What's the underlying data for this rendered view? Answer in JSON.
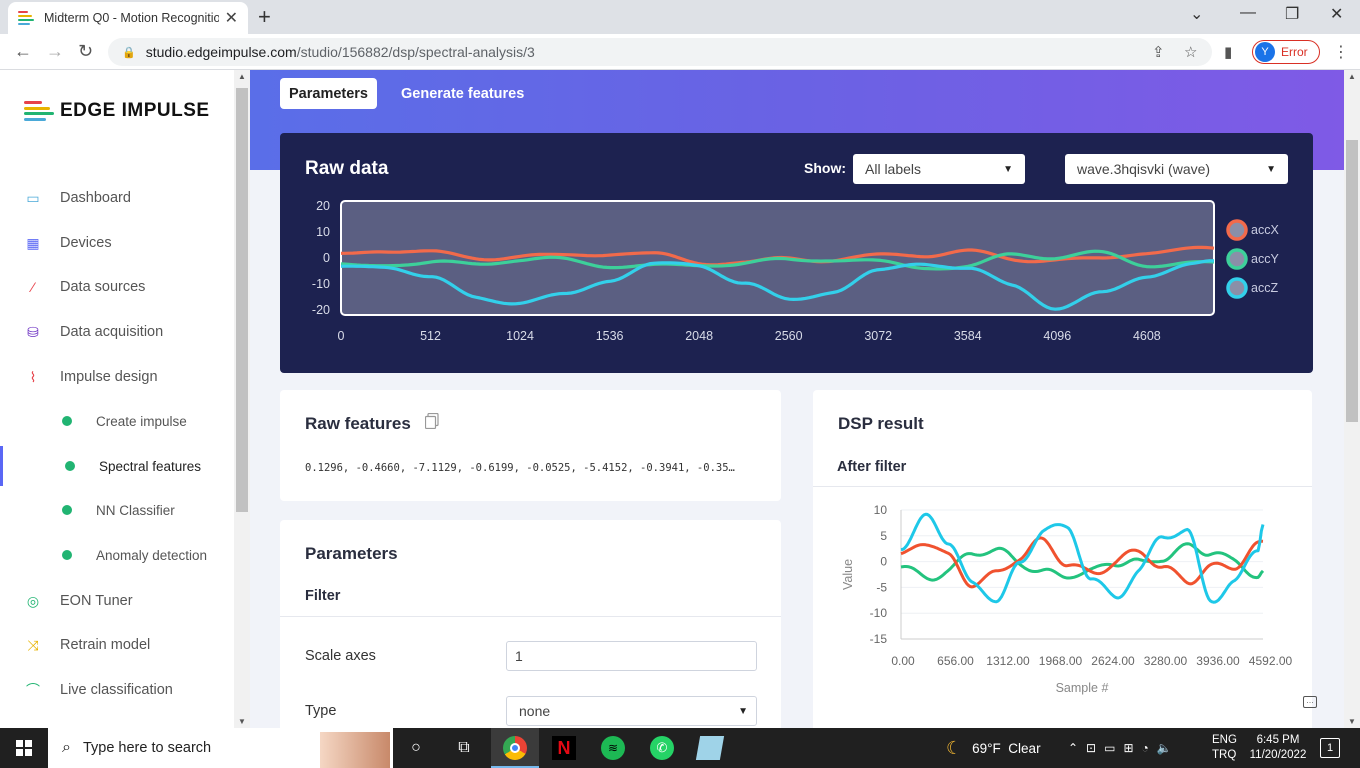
{
  "browser": {
    "tab_title": "Midterm Q0 - Motion Recognitio",
    "url_host": "studio.edgeimpulse.com",
    "url_path": "/studio/156882/dsp/spectral-analysis/3",
    "profile_initial": "Y",
    "profile_status": "Error"
  },
  "sidebar": {
    "brand": "EDGE IMPULSE",
    "items": [
      {
        "label": "Dashboard",
        "icon": "monitor-icon",
        "color": "#4aa9d8"
      },
      {
        "label": "Devices",
        "icon": "chip-icon",
        "color": "#5a67f5"
      },
      {
        "label": "Data sources",
        "icon": "wand-icon",
        "color": "#e7424a"
      },
      {
        "label": "Data acquisition",
        "icon": "database-icon",
        "color": "#6b2fc2"
      },
      {
        "label": "Impulse design",
        "icon": "pulse-icon",
        "color": "#e7424a"
      },
      {
        "label": "Create impulse",
        "sub": true
      },
      {
        "label": "Spectral features",
        "sub": true,
        "active": true
      },
      {
        "label": "NN Classifier",
        "sub": true
      },
      {
        "label": "Anomaly detection",
        "sub": true
      },
      {
        "label": "EON Tuner",
        "icon": "compass-icon",
        "color": "#21b472"
      },
      {
        "label": "Retrain model",
        "icon": "shuffle-icon",
        "color": "#e8b300"
      },
      {
        "label": "Live classification",
        "icon": "signal-icon",
        "color": "#21b472"
      }
    ]
  },
  "tabs": {
    "parameters": "Parameters",
    "generate": "Generate features"
  },
  "raw_data": {
    "title": "Raw data",
    "show_label": "Show:",
    "label_filter": "All labels",
    "sample_select": "wave.3hqisvki (wave)"
  },
  "raw_features": {
    "title": "Raw features",
    "values": "0.1296, -0.4660, -7.1129, -0.6199, -0.0525, -5.4152, -0.3941, -0.35…"
  },
  "parameters": {
    "title": "Parameters",
    "section": "Filter",
    "scale_label": "Scale axes",
    "scale_value": "1",
    "type_label": "Type",
    "type_value": "none"
  },
  "dsp": {
    "title": "DSP result",
    "subtitle": "After filter"
  },
  "chart_data": [
    {
      "type": "line",
      "title": "Raw data",
      "x_ticks": [
        0,
        512,
        1024,
        1536,
        2048,
        2560,
        3072,
        3584,
        4096,
        4608
      ],
      "y_ticks": [
        20,
        10,
        0,
        -10,
        -20
      ],
      "xlim": [
        0,
        4992
      ],
      "ylim": [
        -22,
        22
      ],
      "legend_position": "right",
      "series": [
        {
          "name": "accX",
          "color": "#f26a4b",
          "x": [
            0,
            256,
            512,
            768,
            1024,
            1280,
            1536,
            1792,
            2048,
            2304,
            2560,
            2816,
            3072,
            3328,
            3584,
            3840,
            4096,
            4352,
            4608,
            4864,
            4992
          ],
          "values": [
            0,
            2,
            2,
            1,
            2,
            1,
            1,
            0,
            -2,
            -1,
            1,
            0,
            0,
            0,
            2,
            0,
            1,
            0,
            2,
            2,
            2
          ]
        },
        {
          "name": "accY",
          "color": "#3dd09a",
          "x": [
            0,
            256,
            512,
            768,
            1024,
            1280,
            1536,
            1792,
            2048,
            2304,
            2560,
            2816,
            3072,
            3328,
            3584,
            3840,
            4096,
            4352,
            4608,
            4864,
            4992
          ],
          "values": [
            -2,
            -1,
            -2,
            -3,
            -2,
            -1,
            -2,
            -2,
            -2,
            -3,
            -2,
            -1,
            -1,
            -2,
            -3,
            1,
            -1,
            1,
            -2,
            -1,
            -1
          ]
        },
        {
          "name": "accZ",
          "color": "#33d0ea",
          "x": [
            0,
            256,
            512,
            768,
            1024,
            1280,
            1536,
            1792,
            2048,
            2304,
            2560,
            2816,
            3072,
            3328,
            3584,
            3840,
            4096,
            4352,
            4608,
            4864,
            4992
          ],
          "values": [
            -5,
            -4,
            -8,
            -14,
            -16,
            -14,
            -9,
            -4,
            -3,
            -9,
            -15,
            -12,
            -6,
            -3,
            -5,
            -10,
            -18,
            -13,
            -7,
            -4,
            -3
          ]
        }
      ]
    },
    {
      "type": "line",
      "title": "After filter",
      "xlabel": "Sample #",
      "ylabel": "Value",
      "x_tick_labels": [
        "0.00",
        "656.00",
        "1312.00",
        "1968.00",
        "2624.00",
        "3280.00",
        "3936.00",
        "4592.00"
      ],
      "y_ticks": [
        10,
        5,
        0,
        -5,
        -10,
        -15
      ],
      "xlim": [
        0,
        4992
      ],
      "ylim": [
        -15,
        10
      ],
      "series": [
        {
          "color": "#f0522f",
          "x": [
            0,
            328,
            656,
            984,
            1312,
            1640,
            1968,
            2296,
            2624,
            2952,
            3280,
            3608,
            3936,
            4264,
            4592,
            4920,
            4992
          ],
          "values": [
            0,
            3,
            1,
            -3,
            -2,
            0,
            3,
            0,
            -1,
            0,
            1,
            -2,
            -3,
            0,
            -1,
            2,
            2
          ]
        },
        {
          "color": "#23c37e",
          "x": [
            0,
            328,
            656,
            984,
            1312,
            1640,
            1968,
            2296,
            2624,
            2952,
            3280,
            3608,
            3936,
            4264,
            4592,
            4920,
            4992
          ],
          "values": [
            -1,
            -2,
            -1,
            1,
            1,
            0,
            -1,
            -2,
            -3,
            -1,
            0,
            2,
            3,
            1,
            -1,
            -2,
            -1
          ]
        },
        {
          "color": "#1ec8e8",
          "x": [
            0,
            328,
            656,
            984,
            1312,
            1640,
            1968,
            2296,
            2624,
            2952,
            3280,
            3608,
            3936,
            4264,
            4592,
            4920,
            4992
          ],
          "values": [
            4,
            8,
            3,
            -5,
            -6,
            0,
            6,
            5,
            -3,
            -6,
            -1,
            4,
            5,
            -7,
            -3,
            3,
            8
          ]
        }
      ]
    }
  ],
  "taskbar": {
    "search_placeholder": "Type here to search",
    "weather": "69°F  Clear",
    "lang1": "ENG",
    "lang2": "TRQ",
    "time": "6:45 PM",
    "date": "11/20/2022",
    "notif_count": "1"
  }
}
